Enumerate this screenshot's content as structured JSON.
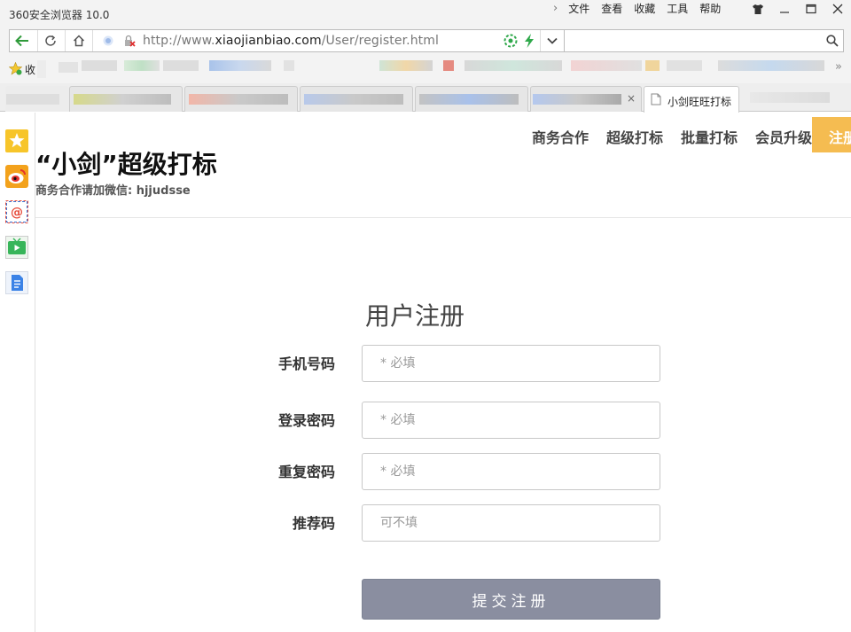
{
  "browser": {
    "title": "360安全浏览器 10.0",
    "menu": [
      "文件",
      "查看",
      "收藏",
      "工具",
      "帮助"
    ],
    "address": {
      "url_prefix": "http://www.",
      "url_host": "xiaojianbiao.com",
      "url_path": "/User/register.html"
    },
    "favorites_label": "收",
    "active_tab_label": "小剑旺旺打标"
  },
  "site": {
    "brand": "“小剑”超级打标",
    "brand_sub": "商务合作请加微信: hjjudsse",
    "nav": [
      "商务合作",
      "超级打标",
      "批量打标",
      "会员升级"
    ],
    "register_button": "注册"
  },
  "form": {
    "title": "用户注册",
    "fields": [
      {
        "label": "手机号码",
        "placeholder": "* 必填"
      },
      {
        "label": "登录密码",
        "placeholder": "* 必填"
      },
      {
        "label": "重复密码",
        "placeholder": "* 必填"
      },
      {
        "label": "推荐码",
        "placeholder": "可不填"
      }
    ],
    "submit_label": "提交注册"
  },
  "colors": {
    "accent_register": "#f5bc51",
    "submit_bg": "#8a8ea0",
    "back_arrow": "#2e9a3a"
  }
}
